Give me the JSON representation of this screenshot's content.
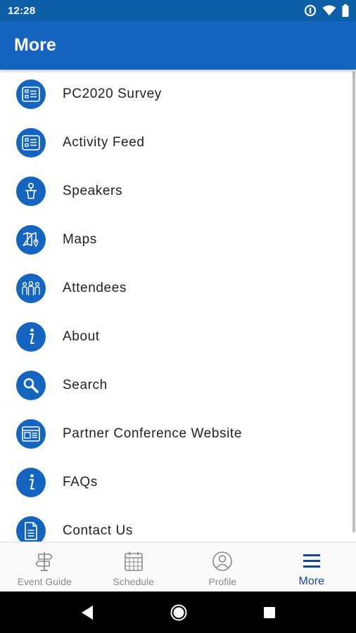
{
  "status_bar": {
    "time": "12:28",
    "icons": [
      "data-saver-icon",
      "wifi-icon",
      "battery-icon"
    ]
  },
  "app_bar": {
    "title": "More"
  },
  "menu": {
    "items": [
      {
        "label": "PC2020 Survey",
        "icon": "list-icon"
      },
      {
        "label": "Activity Feed",
        "icon": "list-icon"
      },
      {
        "label": "Speakers",
        "icon": "speaker-podium-icon"
      },
      {
        "label": "Maps",
        "icon": "map-pin-icon"
      },
      {
        "label": "Attendees",
        "icon": "people-icon"
      },
      {
        "label": "About",
        "icon": "info-icon"
      },
      {
        "label": "Search",
        "icon": "search-icon"
      },
      {
        "label": "Partner Conference Website",
        "icon": "browser-window-icon"
      },
      {
        "label": "FAQs",
        "icon": "info-icon"
      },
      {
        "label": "Contact Us",
        "icon": "document-icon"
      }
    ]
  },
  "bottom_nav": {
    "tabs": [
      {
        "label": "Event Guide",
        "icon": "signpost-icon",
        "active": false
      },
      {
        "label": "Schedule",
        "icon": "calendar-icon",
        "active": false
      },
      {
        "label": "Profile",
        "icon": "user-circle-icon",
        "active": false
      },
      {
        "label": "More",
        "icon": "hamburger-menu-icon",
        "active": true
      }
    ]
  },
  "colors": {
    "status_bar": "#0d5fa8",
    "app_bar": "#1565c0",
    "accent": "#1565c0",
    "active_tab": "#15468f",
    "inactive_tab": "#8a8a8a"
  }
}
